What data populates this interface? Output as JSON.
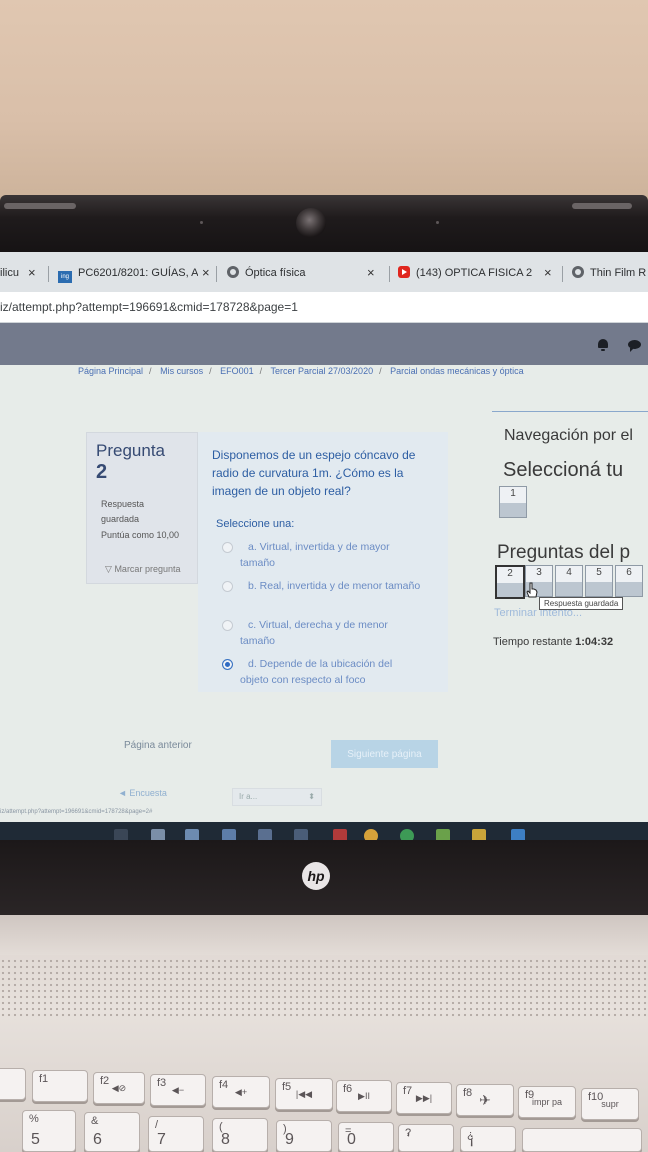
{
  "browser": {
    "tabs": [
      {
        "title": "ilicu",
        "favicon": "page-icon"
      },
      {
        "title": "PC6201/8201: GUÍAS, A",
        "favicon": "ing-icon"
      },
      {
        "title": "Óptica física",
        "favicon": "globe-icon"
      },
      {
        "title": "(143) OPTICA FISICA 2",
        "favicon": "youtube-icon"
      },
      {
        "title": "Thin Film R",
        "favicon": "globe-icon"
      }
    ],
    "close_glyph": "×",
    "url": "iz/attempt.php?attempt=196691&cmid=178728&page=1"
  },
  "breadcrumb": [
    "Página Principal",
    "Mis cursos",
    "EFO001",
    "Tercer Parcial 27/03/2020",
    "Parcial ondas mecánicas y óptica"
  ],
  "question": {
    "heading": "Pregunta",
    "number": "2",
    "state": "Respuesta guardada",
    "marks": "Puntúa como 10,00",
    "flag_label": "Marcar pregunta",
    "text": "Disponemos de un espejo cóncavo de radio de curvatura 1m. ¿Cómo es la imagen de un objeto real?",
    "prompt": "Seleccione una:",
    "options": [
      {
        "label": "a. Virtual, invertida y de mayor tamaño",
        "checked": false
      },
      {
        "label": "b. Real, invertida y de menor tamaño",
        "checked": false
      },
      {
        "label": "c. Virtual, derecha y de menor tamaño",
        "checked": false
      },
      {
        "label": "d. Depende de la ubicación del objeto con respecto al foco",
        "checked": true
      }
    ]
  },
  "footer": {
    "prev": "Página anterior",
    "next": "Siguiente página",
    "back_link": "◄ Encuesta",
    "jump_placeholder": "Ir a...",
    "status_url": "iz/attempt.php?attempt=196691&cmid=178728&page=2#"
  },
  "quiz_nav": {
    "title": "Navegación por el",
    "select_heading": "Seleccioná tu",
    "questions_heading": "Preguntas del p",
    "first_block": [
      "1"
    ],
    "question_buttons": [
      "2",
      "3",
      "4",
      "5",
      "6"
    ],
    "current": "2",
    "finish": "Terminar intento...",
    "tooltip": "Respuesta guardada",
    "time_label": "Tiempo restante",
    "time_value": "1:04:32"
  },
  "colors": {
    "header": "#737a8c",
    "link": "#2d5ea3",
    "next_button": "#b8d4e6"
  },
  "laptop": {
    "brand": "hp",
    "keys_fn": [
      "",
      "f1",
      "f2",
      "f3",
      "f4",
      "f5",
      "f6",
      "f7",
      "f8",
      "f9",
      "f10"
    ],
    "key_labels": [
      "impr pa",
      "supr"
    ],
    "number_keys": [
      {
        "top": "%",
        "main": "5"
      },
      {
        "top": "&",
        "main": "6"
      },
      {
        "top": "/",
        "main": "7"
      },
      {
        "top": "(",
        "main": "8"
      },
      {
        "top": ")",
        "main": "9"
      },
      {
        "top": "=",
        "main": "0"
      },
      {
        "top": "?",
        "main": "'"
      },
      {
        "top": "¿",
        "main": "¡"
      }
    ]
  }
}
